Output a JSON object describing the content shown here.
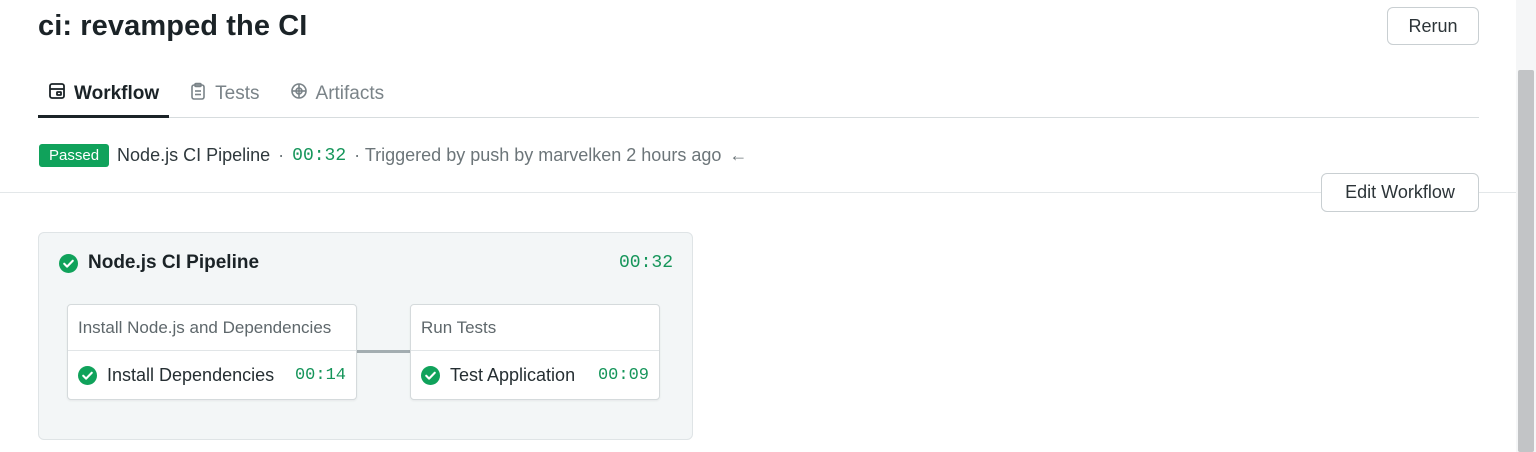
{
  "header": {
    "title": "ci: revamped the CI",
    "rerun_label": "Rerun"
  },
  "tabs": [
    {
      "label": "Workflow",
      "icon": "workflow-icon",
      "active": true
    },
    {
      "label": "Tests",
      "icon": "clipboard-icon",
      "active": false
    },
    {
      "label": "Artifacts",
      "icon": "artifacts-icon",
      "active": false
    }
  ],
  "status": {
    "badge": "Passed",
    "pipeline_name": "Node.js CI Pipeline",
    "separator": "·",
    "duration": "00:32",
    "trigger_text": "· Triggered by push by marvelken 2 hours ago",
    "arrow": "←"
  },
  "edit_workflow_label": "Edit Workflow",
  "pipeline": {
    "name": "Node.js CI Pipeline",
    "duration": "00:32",
    "jobs": [
      {
        "title": "Install Node.js and Dependencies",
        "steps": [
          {
            "name": "Install Dependencies",
            "duration": "00:14",
            "status": "passed"
          }
        ]
      },
      {
        "title": "Run Tests",
        "steps": [
          {
            "name": "Test Application",
            "duration": "00:09",
            "status": "passed"
          }
        ]
      }
    ]
  },
  "colors": {
    "success": "#10a25b",
    "duration_text": "#15955a",
    "text_primary": "#1b2327",
    "text_muted": "#7a8388"
  }
}
